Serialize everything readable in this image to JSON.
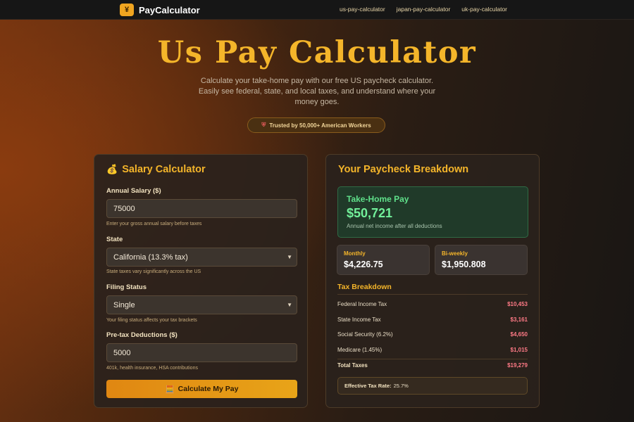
{
  "nav": {
    "brand_icon": "¥",
    "brand_name": "PayCalculator",
    "links": [
      "us-pay-calculator",
      "japan-pay-calculator",
      "uk-pay-calculator"
    ]
  },
  "hero": {
    "title": "Us Pay Calculator",
    "subtitle": "Calculate your take-home pay with our free US paycheck calculator. Easily see federal, state, and local taxes, and understand where your money goes.",
    "badge_icon": "shield-icon",
    "badge_text": "Trusted by 50,000+ American Workers"
  },
  "form": {
    "title": "Salary Calculator",
    "salary": {
      "label": "Annual Salary ($)",
      "value": "75000",
      "hint": "Enter your gross annual salary before taxes"
    },
    "state": {
      "label": "State",
      "value": "California (13.3% tax)",
      "hint": "State taxes vary significantly across the US"
    },
    "filing": {
      "label": "Filing Status",
      "value": "Single",
      "hint": "Your filing status affects your tax brackets"
    },
    "deductions": {
      "label": "Pre-tax Deductions ($)",
      "value": "5000",
      "hint": "401k, health insurance, HSA contributions"
    },
    "button_label": "Calculate My Pay"
  },
  "results": {
    "title": "Your Paycheck Breakdown",
    "take_home": {
      "label": "Take-Home Pay",
      "value": "$50,721",
      "note": "Annual net income after all deductions"
    },
    "monthly": {
      "label": "Monthly",
      "value": "$4,226.75"
    },
    "biweekly": {
      "label": "Bi-weekly",
      "value": "$1,950.808"
    },
    "tax_title": "Tax Breakdown",
    "taxes": [
      {
        "name": "Federal Income Tax",
        "amount": "$10,453"
      },
      {
        "name": "State Income Tax",
        "amount": "$3,161"
      },
      {
        "name": "Social Security (6.2%)",
        "amount": "$4,650"
      },
      {
        "name": "Medicare (1.45%)",
        "amount": "$1,015"
      }
    ],
    "total": {
      "name": "Total Taxes",
      "amount": "$19,279"
    },
    "effective": {
      "label": "Effective Tax Rate:",
      "value": "25.7%"
    }
  },
  "colors": {
    "accent": "#f4b52a",
    "positive": "#72f09a",
    "negative": "#ff7a86",
    "button": "#e8a418"
  }
}
